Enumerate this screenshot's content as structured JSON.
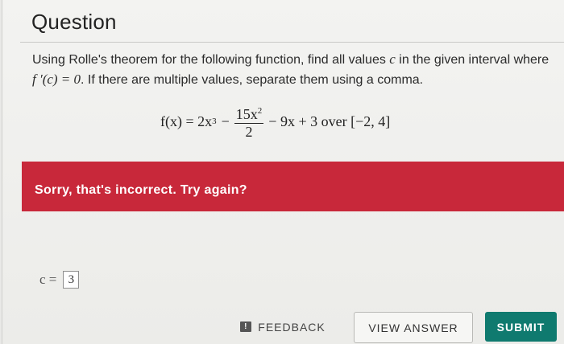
{
  "header": {
    "title": "Question"
  },
  "question": {
    "text_part1": "Using Rolle's theorem for the following function, find all values ",
    "var_c": "c",
    "text_part2": " in the given interval where ",
    "condition": "f ′(c) = 0",
    "text_part3": ". If there are multiple values, separate them using a comma."
  },
  "formula": {
    "lhs": "f(x) = 2x",
    "lhs_exp": "3",
    "minus": "−",
    "frac_num": "15x",
    "frac_num_exp": "2",
    "frac_den": "2",
    "rest": "− 9x + 3 over [−2, 4]"
  },
  "feedback_banner": {
    "text": "Sorry, that's incorrect. Try again?",
    "color": "#c8283a"
  },
  "answer": {
    "label": "c =",
    "value": "3"
  },
  "buttons": {
    "feedback": "FEEDBACK",
    "feedback_icon": "!",
    "view_answer": "VIEW ANSWER",
    "submit": "SUBMIT",
    "submit_color": "#0f7a6f"
  }
}
